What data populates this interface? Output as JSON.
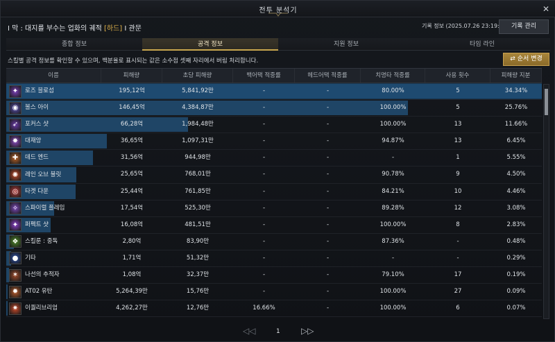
{
  "window": {
    "title": "전투 분석기"
  },
  "header": {
    "raid_prefix": "I 막 : 대지를 부수는 업화의 궤적 ",
    "difficulty": "[하드]",
    "raid_suffix": " I 관문",
    "record_info": "기록 정보 (2025.07.26 23:19:10)",
    "record_button": "기록 관리"
  },
  "tabs": [
    "종합 정보",
    "공격 정보",
    "지원 정보",
    "타임 라인"
  ],
  "description": "스킬별 공격 정보를 확인할 수 있으며, 백분율로 표시되는 값은 소수점 셋째 자리에서 버림 처리합니다.",
  "sort_button": "순서 변경",
  "columns": [
    "이름",
    "피해량",
    "초당 피해량",
    "백어택 적중률",
    "헤드어택 적중률",
    "치명타 적중률",
    "사용 횟수",
    "피해량 지분"
  ],
  "rows": [
    {
      "name": "로즈 블로섬",
      "damage": "195,12억",
      "dps": "5,841,92만",
      "back": "-",
      "head": "-",
      "crit": "80.00%",
      "uses": "5",
      "share": "34.34%",
      "share_value": 34.34,
      "icon": "rose-blossom-icon",
      "color": "#7a3fb8"
    },
    {
      "name": "볼스 아이",
      "damage": "146,45억",
      "dps": "4,384,87만",
      "back": "-",
      "head": "-",
      "crit": "100.00%",
      "uses": "5",
      "share": "25.76%",
      "share_value": 25.76,
      "icon": "bulls-eye-icon",
      "color": "#5a4fb0"
    },
    {
      "name": "포커스 샷",
      "damage": "66,28억",
      "dps": "1,984,48만",
      "back": "-",
      "head": "-",
      "crit": "100.00%",
      "uses": "13",
      "share": "11.66%",
      "share_value": 11.66,
      "icon": "focus-shot-icon",
      "color": "#6a3aa8"
    },
    {
      "name": "대재앙",
      "damage": "36,65억",
      "dps": "1,097,31만",
      "back": "-",
      "head": "-",
      "crit": "94.87%",
      "uses": "13",
      "share": "6.45%",
      "share_value": 6.45,
      "icon": "catastrophe-icon",
      "color": "#8a4bc0"
    },
    {
      "name": "데드 엔드",
      "damage": "31,56억",
      "dps": "944,98만",
      "back": "-",
      "head": "-",
      "crit": "-",
      "uses": "1",
      "share": "5.55%",
      "share_value": 5.55,
      "icon": "dead-end-icon",
      "color": "#b8642a"
    },
    {
      "name": "레인 오브 불릿",
      "damage": "25,65억",
      "dps": "768,01만",
      "back": "-",
      "head": "-",
      "crit": "90.78%",
      "uses": "9",
      "share": "4.50%",
      "share_value": 4.5,
      "icon": "rain-of-bullets-icon",
      "color": "#c44a2a"
    },
    {
      "name": "타겟 다운",
      "damage": "25,44억",
      "dps": "761,85만",
      "back": "-",
      "head": "-",
      "crit": "84.21%",
      "uses": "10",
      "share": "4.46%",
      "share_value": 4.46,
      "icon": "target-down-icon",
      "color": "#b83a3a"
    },
    {
      "name": "스파이럴 플레임",
      "damage": "17,54억",
      "dps": "525,30만",
      "back": "-",
      "head": "-",
      "crit": "89.28%",
      "uses": "12",
      "share": "3.08%",
      "share_value": 3.08,
      "icon": "spiral-flame-icon",
      "color": "#7a48b8"
    },
    {
      "name": "퍼펙트 샷",
      "damage": "16,08억",
      "dps": "481,51만",
      "back": "-",
      "head": "-",
      "crit": "100.00%",
      "uses": "8",
      "share": "2.83%",
      "share_value": 2.83,
      "icon": "perfect-shot-icon",
      "color": "#8a3fc8"
    },
    {
      "name": "스킬룬 : 중독",
      "damage": "2,80억",
      "dps": "83,90만",
      "back": "-",
      "head": "-",
      "crit": "87.36%",
      "uses": "-",
      "share": "0.48%",
      "share_value": 0.48,
      "icon": "skill-rune-poison-icon",
      "color": "#4f8a2a"
    },
    {
      "name": "기타",
      "damage": "1,71억",
      "dps": "51,32만",
      "back": "-",
      "head": "-",
      "crit": "-",
      "uses": "-",
      "share": "0.29%",
      "share_value": 0.29,
      "icon": "misc-icon",
      "color": "#2a4fa8"
    },
    {
      "name": "나선의 추적자",
      "damage": "1,08억",
      "dps": "32,37만",
      "back": "-",
      "head": "-",
      "crit": "79.10%",
      "uses": "17",
      "share": "0.19%",
      "share_value": 0.19,
      "icon": "spiral-tracker-icon",
      "color": "#a04a2a"
    },
    {
      "name": "AT02 유탄",
      "damage": "5,264,39만",
      "dps": "15,76만",
      "back": "-",
      "head": "-",
      "crit": "100.00%",
      "uses": "27",
      "share": "0.09%",
      "share_value": 0.09,
      "icon": "at02-grenade-icon",
      "color": "#b85a2a"
    },
    {
      "name": "이퀄리브리엄",
      "damage": "4,262,27만",
      "dps": "12,76만",
      "back": "16.66%",
      "head": "-",
      "crit": "100.00%",
      "uses": "6",
      "share": "0.07%",
      "share_value": 0.07,
      "icon": "equilibrium-icon",
      "color": "#c84a2a"
    }
  ],
  "pager": {
    "prev": "◁◁",
    "page": "1",
    "next": "▷▷"
  }
}
